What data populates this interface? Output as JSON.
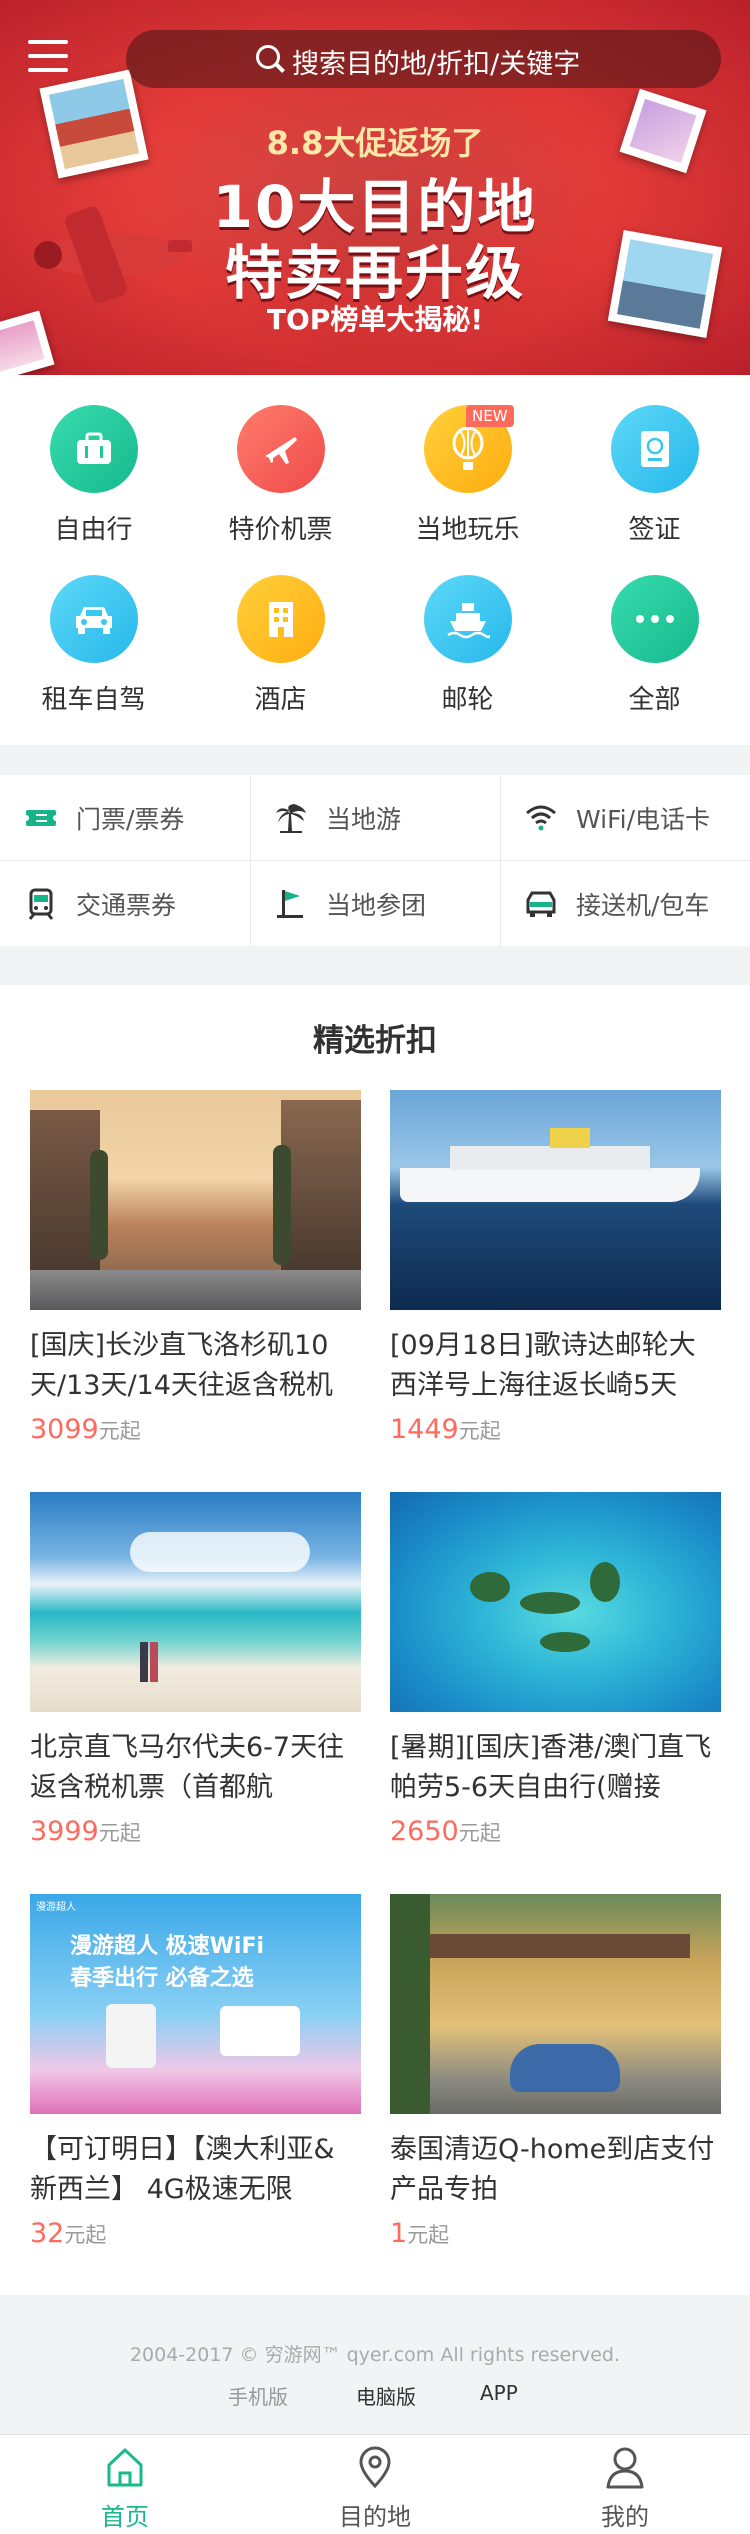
{
  "search": {
    "placeholder": "搜索目的地/折扣/关键字"
  },
  "banner": {
    "line1": "8.8大促返场了",
    "line2": "10大目的地",
    "line3": "特卖再升级",
    "line4": "TOP榜单大揭秘!"
  },
  "categories": [
    {
      "label": "自由行",
      "color": "#1fc99a",
      "icon": "suitcase-icon"
    },
    {
      "label": "特价机票",
      "color": "#f5615a",
      "icon": "airplane-icon"
    },
    {
      "label": "当地玩乐",
      "color": "#ffbe1e",
      "icon": "balloon-icon",
      "badge": "NEW"
    },
    {
      "label": "签证",
      "color": "#35c8f0",
      "icon": "passport-icon"
    },
    {
      "label": "租车自驾",
      "color": "#35c8f0",
      "icon": "car-icon"
    },
    {
      "label": "酒店",
      "color": "#ffbe1e",
      "icon": "hotel-icon"
    },
    {
      "label": "邮轮",
      "color": "#35c8f0",
      "icon": "ship-icon"
    },
    {
      "label": "全部",
      "color": "#1fc99a",
      "icon": "more-icon"
    }
  ],
  "subcategories": [
    {
      "label": "门票/票券",
      "icon": "ticket-icon"
    },
    {
      "label": "当地游",
      "icon": "palm-tree-icon"
    },
    {
      "label": "WiFi/电话卡",
      "icon": "wifi-icon"
    },
    {
      "label": "交通票券",
      "icon": "train-icon"
    },
    {
      "label": "当地参团",
      "icon": "flag-icon"
    },
    {
      "label": "接送机/包车",
      "icon": "van-icon"
    }
  ],
  "deals": {
    "title": "精选折扣",
    "unit": "元起",
    "items": [
      {
        "title": "[国庆]长沙直飞洛杉矶10天/13天/14天往返含税机",
        "price": "3099"
      },
      {
        "title": "[09月18日]歌诗达邮轮大西洋号上海往返长崎5天",
        "price": "1449"
      },
      {
        "title": "北京直飞马尔代夫6-7天往返含税机票（首都航",
        "price": "3999"
      },
      {
        "title": "[暑期][国庆]香港/澳门直飞帕劳5-6天自由行(赠接",
        "price": "2650"
      },
      {
        "title": "【可订明日】【澳大利亚&新西兰】 4G极速无限",
        "price": "32"
      },
      {
        "title": "泰国清迈Q-home到店支付产品专拍",
        "price": "1"
      }
    ],
    "ad_text": {
      "line1": "漫游超人  极速WiFi",
      "line2": "春季出行  必备之选",
      "logo": "漫游超人"
    }
  },
  "footer": {
    "copyright": "2004-2017 © 穷游网™ qyer.com All rights reserved.",
    "links": [
      "手机版",
      "电脑版",
      "APP"
    ]
  },
  "tabbar": [
    {
      "label": "首页",
      "icon": "home-icon",
      "active": true
    },
    {
      "label": "目的地",
      "icon": "location-pin-icon",
      "active": false
    },
    {
      "label": "我的",
      "icon": "user-icon",
      "active": false
    }
  ],
  "colors": {
    "accent": "#19b98b",
    "price": "#fe6a5e",
    "banner": "#e23a38"
  }
}
